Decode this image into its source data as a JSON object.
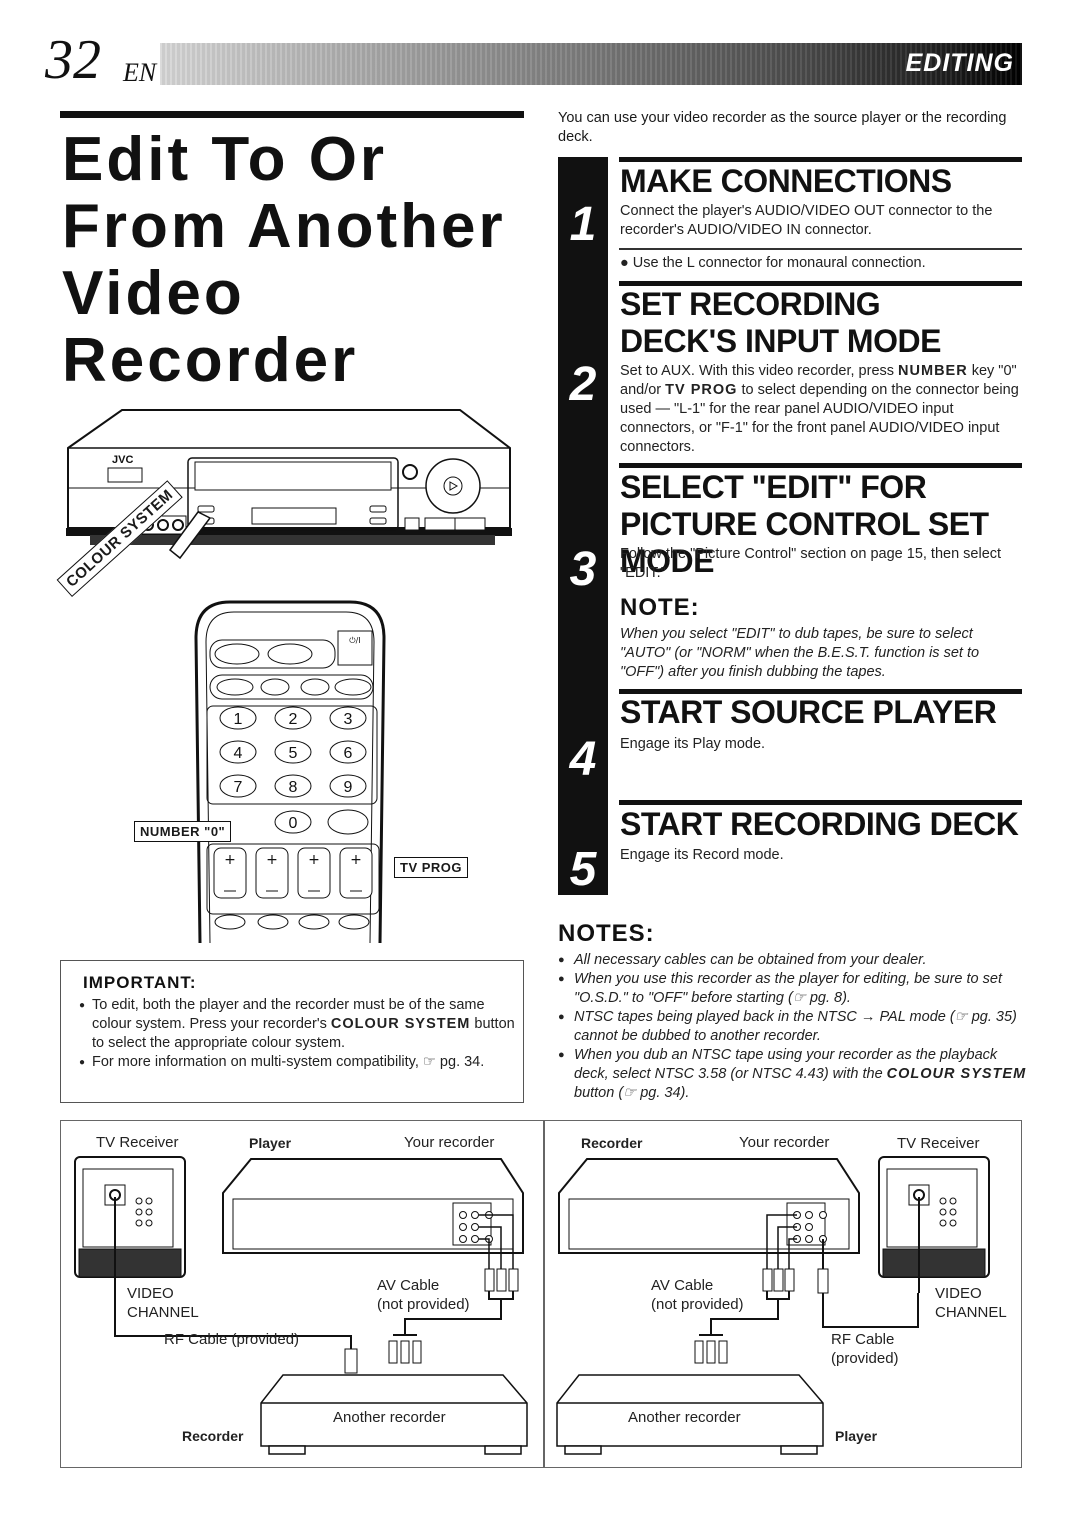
{
  "header": {
    "page_number": "32",
    "language": "EN",
    "section": "EDITING"
  },
  "title": "Edit To Or From Another Video Recorder",
  "intro": "You can use your video recorder as the source player or the recording deck.",
  "steps": [
    {
      "number": "1",
      "title": "MAKE CONNECTIONS",
      "text": "Connect the player's AUDIO/VIDEO OUT connector to the recorder's AUDIO/VIDEO IN connector.",
      "bullet": "Use the L connector for monaural connection."
    },
    {
      "number": "2",
      "title": "SET RECORDING DECK'S INPUT MODE",
      "text_before_number": "Set to AUX. With this video recorder, press ",
      "kw_number": "NUMBER",
      "text_mid": " key \"0\" and/or ",
      "kw_tvprog": "TV PROG",
      "text_after": " to select depending on the connector being used — \"L-1\" for the rear panel AUDIO/VIDEO input connectors, or \"F-1\" for the front panel AUDIO/VIDEO input connectors."
    },
    {
      "number": "3",
      "title": "SELECT \"EDIT\" FOR PICTURE CONTROL SET MODE",
      "text": "Follow the \"Picture Control\" section on page 15, then select \"EDIT.\"",
      "note_heading": "NOTE:",
      "note_text": "When you select \"EDIT\" to dub tapes, be sure to select \"AUTO\" (or \"NORM\" when the B.E.S.T. function is set to \"OFF\") after you finish dubbing the tapes."
    },
    {
      "number": "4",
      "title": "START SOURCE PLAYER",
      "text": "Engage its Play mode."
    },
    {
      "number": "5",
      "title": "START RECORDING DECK",
      "text": "Engage its Record mode."
    }
  ],
  "notes": {
    "heading": "NOTES:",
    "items": [
      "All necessary cables can be obtained from your dealer.",
      "When you use this recorder as the player for editing, be sure to set \"O.S.D.\" to  \"OFF\" before starting (☞ pg. 8).",
      "NTSC tapes being played back in the NTSC → PAL mode (☞ pg. 35) cannot be dubbed to another recorder."
    ],
    "last_item_text": "When you dub an NTSC tape using your recorder as the playback deck, select NTSC 3.58 (or NTSC 4.43) with the ",
    "last_item_kw": "COLOUR SYSTEM",
    "last_item_end": " button (☞ pg. 34)."
  },
  "important": {
    "heading": "IMPORTANT:",
    "item1_text": "To edit, both the player and the recorder must be of the same colour system. Press your recorder's ",
    "item1_kw": "COLOUR SYSTEM",
    "item1_end": " button to select the appropriate colour system.",
    "item2": "For more information on multi-system compatibility, ☞ pg. 34."
  },
  "illustration": {
    "vcr_brand": "JVC",
    "colour_system_label": "COLOUR SYSTEM",
    "number_label": "NUMBER \"0\"",
    "tv_prog_label": "TV PROG",
    "keypad": [
      "1",
      "2",
      "3",
      "4",
      "5",
      "6",
      "7",
      "8",
      "9",
      "0"
    ]
  },
  "diagram": {
    "left": {
      "tv_label": "TV Receiver",
      "role_label": "Player",
      "device_label": "Your recorder",
      "video_channel": "VIDEO CHANNEL",
      "av_cable": "AV Cable",
      "av_cable_note": "(not provided)",
      "rf_cable": "RF Cable (provided)",
      "other_device": "Another recorder",
      "other_role": "Recorder"
    },
    "right": {
      "role_label": "Recorder",
      "device_label": "Your recorder",
      "tv_label": "TV Receiver",
      "video_channel": "VIDEO CHANNEL",
      "av_cable": "AV Cable",
      "av_cable_note": "(not provided)",
      "rf_cable": "RF Cable",
      "rf_cable_note": "(provided)",
      "other_device": "Another recorder",
      "other_role": "Player"
    }
  }
}
